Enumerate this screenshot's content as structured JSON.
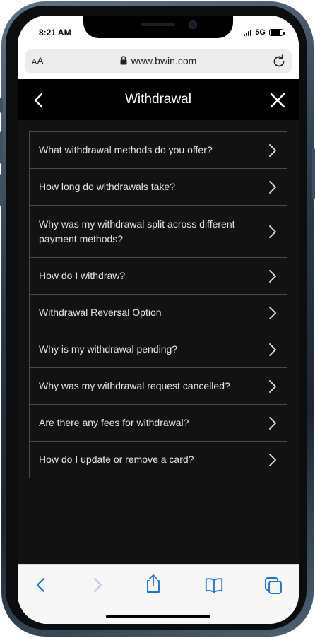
{
  "status_bar": {
    "time": "8:21 AM",
    "network": "5G",
    "battery_level": 0.9
  },
  "browser": {
    "text_size_label_large": "A",
    "text_size_label_small": "A",
    "url": "www.bwin.com",
    "lock_icon": "lock-icon",
    "reload_icon": "reload-icon"
  },
  "header": {
    "title": "Withdrawal",
    "back_icon": "chevron-left-icon",
    "close_icon": "close-icon"
  },
  "faq": {
    "items": [
      {
        "label": "What withdrawal methods do you offer?"
      },
      {
        "label": "How long do withdrawals take?"
      },
      {
        "label": "Why was my withdrawal split across different payment methods?"
      },
      {
        "label": "How do I withdraw?"
      },
      {
        "label": "Withdrawal Reversal Option"
      },
      {
        "label": "Why is my withdrawal pending?"
      },
      {
        "label": "Why was my withdrawal request cancelled?"
      },
      {
        "label": "Are there any fees for withdrawal?"
      },
      {
        "label": "How do I update or remove a card?"
      }
    ]
  },
  "toolbar": {
    "icons": [
      "back-icon",
      "forward-icon",
      "share-icon",
      "bookmarks-icon",
      "tabs-icon"
    ]
  },
  "colors": {
    "accent": "#1a73d9",
    "background": "#121212",
    "header": "#000000",
    "border": "#4a4a4a"
  }
}
